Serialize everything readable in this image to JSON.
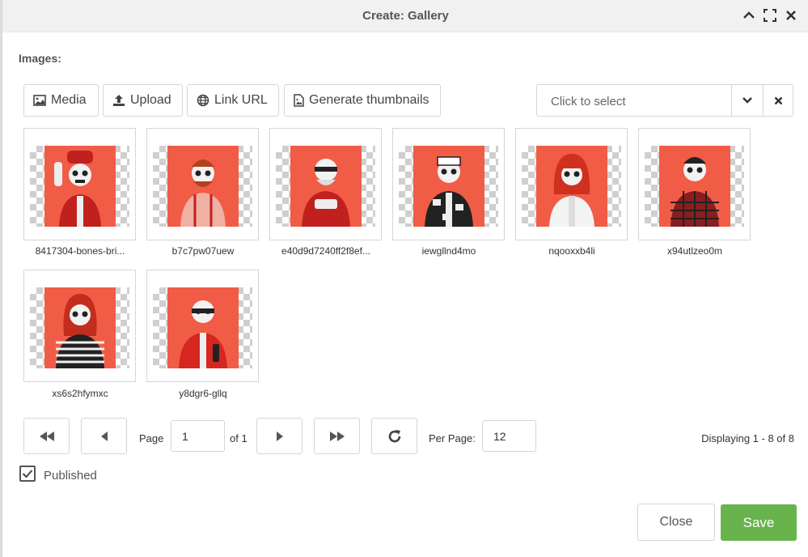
{
  "dialog": {
    "title": "Create: Gallery"
  },
  "images_section": {
    "label": "Images:"
  },
  "toolbar": {
    "media_label": "Media",
    "upload_label": "Upload",
    "link_url_label": "Link URL",
    "generate_label": "Generate thumbnails"
  },
  "select": {
    "placeholder": "Click to select"
  },
  "gallery": {
    "items": [
      {
        "caption": "8417304-bones-bri..."
      },
      {
        "caption": "b7c7pw07uew"
      },
      {
        "caption": "e40d9d7240ff2f8ef..."
      },
      {
        "caption": "iewgllnd4mo"
      },
      {
        "caption": "nqooxxb4li"
      },
      {
        "caption": "x94utlzeo0m"
      },
      {
        "caption": "xs6s2hfymxc"
      },
      {
        "caption": "y8dgr6-gllq"
      }
    ]
  },
  "pagination": {
    "page_label": "Page",
    "page_value": "1",
    "of_label": "of 1",
    "per_page_label": "Per Page:",
    "per_page_value": "12",
    "displaying": "Displaying 1 - 8 of 8"
  },
  "published": {
    "label": "Published",
    "checked": true
  },
  "footer": {
    "close_label": "Close",
    "save_label": "Save"
  },
  "colors": {
    "save": "#69b34c",
    "art_background": "#f15c46"
  }
}
